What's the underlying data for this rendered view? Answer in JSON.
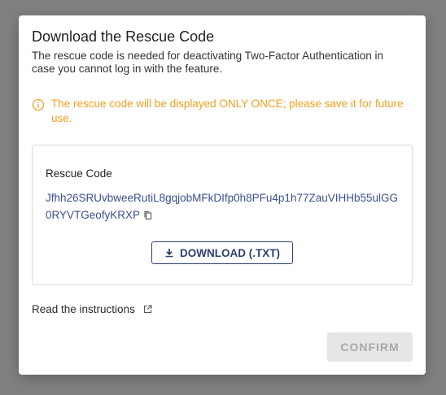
{
  "dialog": {
    "title": "Download the Rescue Code",
    "description": "The rescue code is needed for deactivating Two-Factor Authentication in case you cannot log in with the feature.",
    "warning": "The rescue code will be displayed ONLY ONCE; please save it for future use.",
    "warning_icon": "info-circle-icon",
    "code_label": "Rescue Code",
    "code_value": "Jfhh26SRUvbweeRutiL8gqjobMFkDIfp0h8PFu4p1h77ZauVIHHb55ulGG0RYVTGeofyKRXP",
    "copy_icon": "copy-icon",
    "download_label": "DOWNLOAD (.TXT)",
    "download_icon": "download-icon",
    "instructions_link": "Read the instructions",
    "external_icon": "external-link-icon",
    "confirm_label": "CONFIRM"
  },
  "colors": {
    "overlay": "#808080",
    "warning": "#f0a020",
    "code_text": "#3a4f8f",
    "primary": "#2f3f72",
    "disabled_bg": "#e6e6e6",
    "disabled_text": "#a8a8a8"
  }
}
